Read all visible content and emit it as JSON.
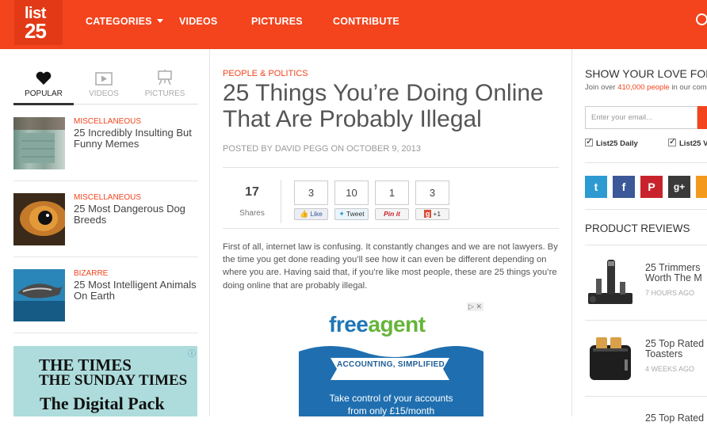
{
  "colors": {
    "brand": "#f3441d",
    "facebook": "#3b5998",
    "twitter": "#2e9ad2",
    "pinterest": "#c8232c",
    "googleplus": "#3a3a3a",
    "rss": "#f39a1d"
  },
  "header": {
    "logo_line1": "list",
    "logo_line2": "25",
    "nav": [
      {
        "label": "CATEGORIES",
        "has_dropdown": true
      },
      {
        "label": "VIDEOS"
      },
      {
        "label": "PICTURES"
      },
      {
        "label": "CONTRIBUTE"
      }
    ],
    "search_icon": "search-icon"
  },
  "sidebar": {
    "tabs": [
      {
        "label": "POPULAR",
        "icon": "heart-icon",
        "active": true
      },
      {
        "label": "VIDEOS",
        "icon": "video-icon"
      },
      {
        "label": "PICTURES",
        "icon": "easel-icon"
      }
    ],
    "stories": [
      {
        "category": "MISCELLANEOUS",
        "title": "25 Incredibly Insulting But Funny Memes"
      },
      {
        "category": "MISCELLANEOUS",
        "title": "25 Most Dangerous Dog Breeds"
      },
      {
        "category": "BIZARRE",
        "title": "25 Most Intelligent Animals On Earth"
      }
    ],
    "ad": {
      "close": "ⓘ",
      "line1": "THE TIMES",
      "line2": "THE SUNDAY TIMES",
      "line3": "The Digital Pack"
    }
  },
  "article": {
    "category": "PEOPLE & POLITICS",
    "title": "25 Things You’re Doing Online That Are Probably Illegal",
    "byline": "POSTED BY DAVID PEGG ON OCTOBER 9, 2013",
    "shares_count": "17",
    "shares_label": "Shares",
    "social_counts": [
      {
        "count": "3",
        "button": "Like",
        "icon": "facebook-like-icon"
      },
      {
        "count": "10",
        "button": "Tweet",
        "icon": "twitter-icon"
      },
      {
        "count": "1",
        "button": "Pin it",
        "icon": "pinterest-icon"
      },
      {
        "count": "3",
        "button": "+1",
        "icon": "google-plus-icon"
      }
    ],
    "intro": "First of all, internet law is confusing. It constantly changes and we are not lawyers. By the time you get done reading you’ll see how it can even be different depending on where you are. Having said that, if you’re like most people, these are 25 things you’re doing online that are probably illegal.",
    "ad": {
      "brand_part1": "free",
      "brand_part2": "agent",
      "tagline": "ACCOUNTING, SIMPLIFIED",
      "line1": "Take control of your accounts",
      "line2": "from only £15/month",
      "controls": "▷ ✕"
    }
  },
  "newsletter": {
    "title": "SHOW YOUR LOVE FOR LI",
    "sub_before": "Join over ",
    "sub_highlight": "410,000 people",
    "sub_after": " in our com",
    "email_placeholder": "Enter your email...",
    "options": [
      "List25 Daily",
      "List25 V"
    ]
  },
  "social_follow": [
    {
      "network": "twitter",
      "glyph": "t"
    },
    {
      "network": "facebook",
      "glyph": "f"
    },
    {
      "network": "pinterest",
      "glyph": "P"
    },
    {
      "network": "googleplus",
      "glyph": "g+"
    },
    {
      "network": "rss",
      "glyph": ""
    }
  ],
  "product_reviews": {
    "title": "PRODUCT REVIEWS",
    "items": [
      {
        "title_line1": "25 Trimmers",
        "title_line2": "Worth The M",
        "time": "7 HOURS AGO"
      },
      {
        "title_line1": "25 Top Rated",
        "title_line2": "Toasters",
        "time": "4 WEEKS AGO"
      }
    ],
    "cut_item_title": "25 Top Rated"
  }
}
